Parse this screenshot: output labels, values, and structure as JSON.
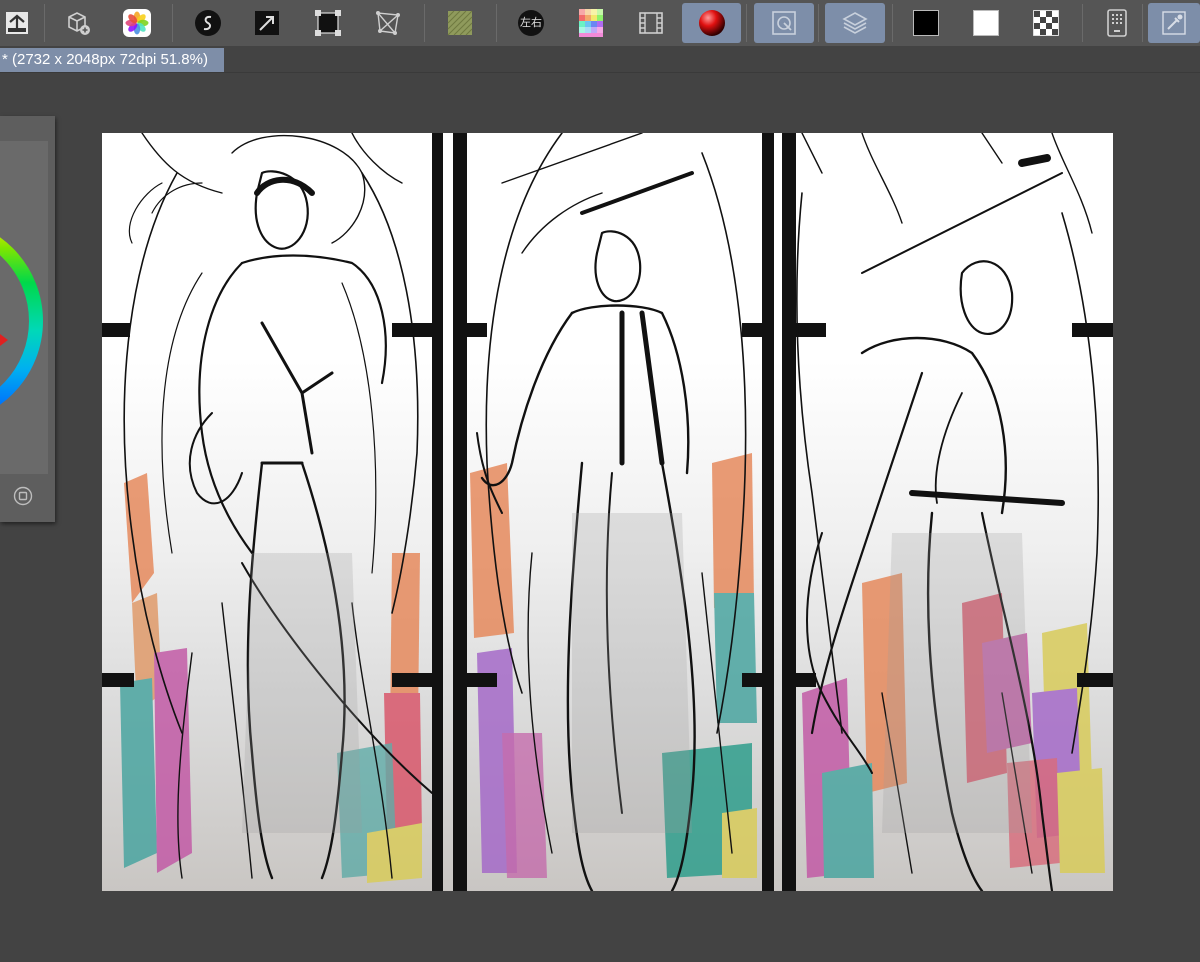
{
  "toolbar": {
    "buttons": [
      {
        "name": "save-button",
        "icon": "save-tray-icon"
      },
      {
        "name": "add-3d-material-button",
        "icon": "cube-plus-icon"
      },
      {
        "name": "photos-button",
        "icon": "photos-flower-icon"
      },
      {
        "name": "smoothing-button",
        "icon": "s-curve-icon"
      },
      {
        "name": "pen-pressure-button",
        "icon": "arrow-pen-icon"
      },
      {
        "name": "transform-button",
        "icon": "transform-box-icon"
      },
      {
        "name": "mesh-transform-button",
        "icon": "mesh-transform-icon"
      },
      {
        "name": "texture-button",
        "icon": "texture-square-icon"
      },
      {
        "name": "flip-horizontal-button",
        "label": "左右",
        "icon": "flip-text-icon"
      },
      {
        "name": "palette-grid-button",
        "icon": "color-grid-icon"
      },
      {
        "name": "filmstrip-button",
        "icon": "filmstrip-icon"
      },
      {
        "name": "color-sphere-button",
        "icon": "red-sphere-icon",
        "active": true
      },
      {
        "name": "navigator-button",
        "icon": "navigator-icon",
        "active": true
      },
      {
        "name": "layers-button",
        "icon": "layers-stack-icon",
        "active": true
      },
      {
        "name": "main-color-button",
        "icon": "black-swatch-icon"
      },
      {
        "name": "sub-color-button",
        "icon": "white-swatch-icon"
      },
      {
        "name": "transparent-color-button",
        "icon": "checker-swatch-icon"
      },
      {
        "name": "device-settings-button",
        "icon": "tablet-icon"
      },
      {
        "name": "eyedropper-button",
        "icon": "eyedropper-icon",
        "active": true
      }
    ]
  },
  "document": {
    "tab_title": "* (2732 x 2048px 72dpi 51.8%)"
  },
  "colors": {
    "toolbar_bg": "#555555",
    "workspace_bg": "#434343",
    "accent": "#7e8ea8",
    "panel_bg": "#5e5e5e"
  }
}
